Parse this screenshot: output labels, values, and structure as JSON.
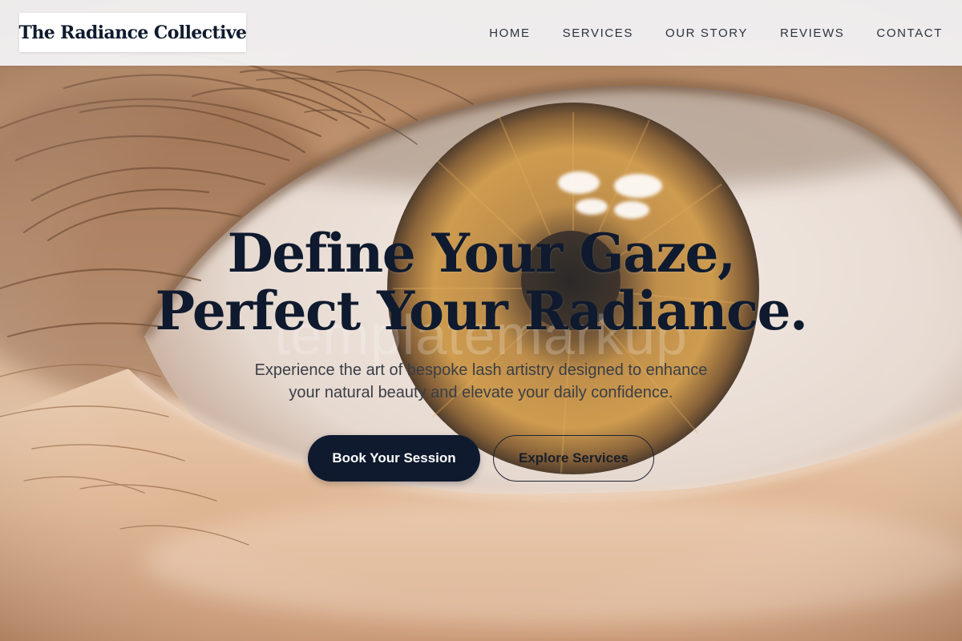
{
  "brand": {
    "name": "The Radiance Collective"
  },
  "nav": {
    "items": [
      {
        "label": "HOME"
      },
      {
        "label": "SERVICES"
      },
      {
        "label": "OUR STORY"
      },
      {
        "label": "REVIEWS"
      },
      {
        "label": "CONTACT"
      }
    ]
  },
  "hero": {
    "headline_line1": "Define Your Gaze,",
    "headline_line2": "Perfect Your Radiance.",
    "watermark": "templatemarkup",
    "subtext_line1": "Experience the art of bespoke lash artistry designed to enhance",
    "subtext_line2": "your natural beauty and elevate your daily confidence.",
    "primary_cta": "Book Your Session",
    "secondary_cta": "Explore Services",
    "background_image": "close-up-eye-photo"
  },
  "colors": {
    "navy": "#0f1a2e",
    "header_bg": "#f4f4f7",
    "iris": "#b8843a",
    "skin": "#d8b08a"
  }
}
